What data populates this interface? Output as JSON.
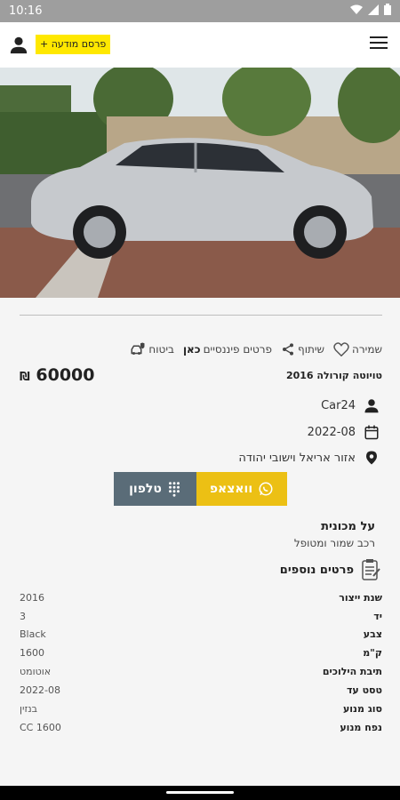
{
  "status": {
    "time": "10:16"
  },
  "header": {
    "post_label": "+ פרסם מודעה"
  },
  "actions": {
    "save": "שמירה",
    "share": "שיתוף",
    "finance_prefix": "פרטים פיננסיים",
    "finance_link": "כאן",
    "insurance": "ביטוח"
  },
  "listing": {
    "price": "60000",
    "currency": "₪",
    "title": "טויוטה קורולה 2016",
    "seller": "Car24",
    "date": "2022-08",
    "location": "אזור אריאל וישובי יהודה"
  },
  "buttons": {
    "whatsapp": "וואצאפ",
    "phone": "טלפון"
  },
  "about": {
    "title": "על מכונית",
    "text": "רכב שמור ומטופל"
  },
  "extra": {
    "title": "פרטים נוספים"
  },
  "specs": [
    {
      "label": "שנת ייצור",
      "value": "2016"
    },
    {
      "label": "יד",
      "value": "3"
    },
    {
      "label": "צבע",
      "value": "Black"
    },
    {
      "label": "ק\"מ",
      "value": "1600"
    },
    {
      "label": "תיבת הילוכים",
      "value": "אוטומט"
    },
    {
      "label": "טסט עד",
      "value": "2022-08"
    },
    {
      "label": "סוג מנוע",
      "value": "בנזין"
    },
    {
      "label": "נפח מנוע",
      "value": "1600 CC"
    }
  ],
  "colors": {
    "accent": "#ffe800",
    "whatsapp": "#ecc014",
    "phone": "#5a6c78"
  }
}
